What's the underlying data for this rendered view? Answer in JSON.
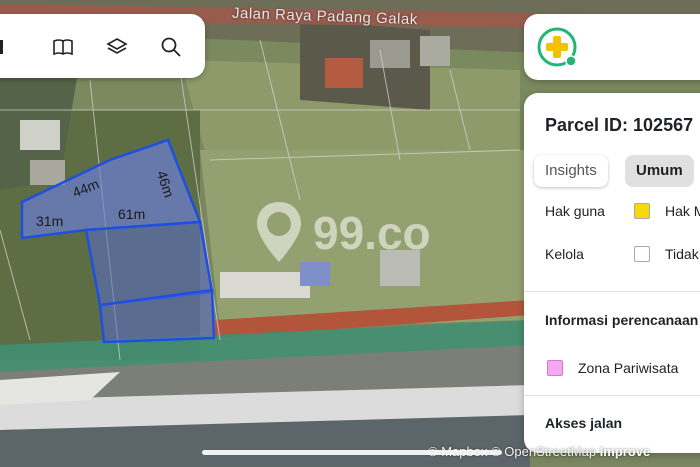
{
  "map": {
    "street_name": "Jalan Raya Padang Galak",
    "dimensions": [
      "44m",
      "46m",
      "31m",
      "61m"
    ],
    "watermark_text": "99.co",
    "attribution": {
      "mapbox": "© Mapbox",
      "osm": "© OpenStreetMap",
      "improve": "Improve"
    }
  },
  "toolbar": {
    "icons": [
      "menu-icon",
      "book-icon",
      "layers-icon",
      "search-icon"
    ]
  },
  "panel": {
    "parcel_label": "Parcel ID: 102567",
    "tabs": [
      {
        "label": "Insights"
      },
      {
        "label": "Umum"
      }
    ],
    "rows": [
      {
        "label": "Hak guna",
        "color": "#f5d90a",
        "value": "Hak M"
      },
      {
        "label": "Kelola",
        "color": "#ffffff",
        "value": "Tidak"
      }
    ],
    "planning_title": "Informasi perencanaan",
    "zone": {
      "color": "#f7a6f2",
      "label": "Zona Pariwisata"
    },
    "road_title": "Akses jalan"
  },
  "colors": {
    "parcel_fill": "#6c7fe0",
    "parcel_stroke": "#1f4fe0",
    "accent_green": "#22b573",
    "plus_yellow": "#f2c200"
  }
}
